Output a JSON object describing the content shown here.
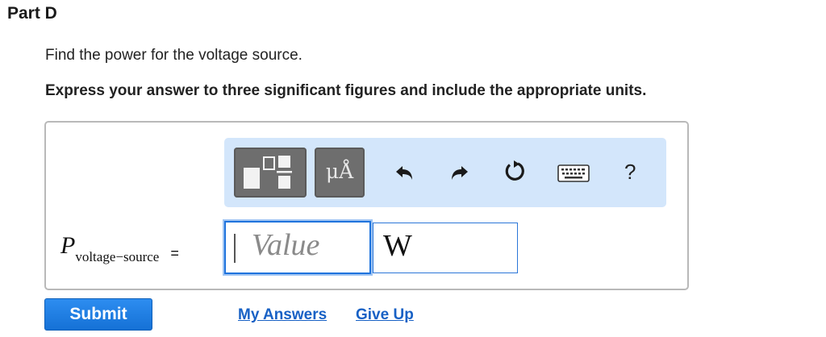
{
  "part": {
    "title": "Part D"
  },
  "question": {
    "text": "Find the power for the voltage source.",
    "instruction": "Express your answer to three significant figures and include the appropriate units."
  },
  "toolbar": {
    "template_icon": "fraction-template-icon",
    "units_label": "μÅ",
    "undo_icon": "undo-icon",
    "redo_icon": "redo-icon",
    "reset_icon": "reset-icon",
    "keyboard_icon": "keyboard-icon",
    "help_label": "?"
  },
  "equation": {
    "symbol": "P",
    "subscript": "voltage−source",
    "equals": "="
  },
  "inputs": {
    "value_placeholder": "Value",
    "unit_value": "W"
  },
  "actions": {
    "submit_label": "Submit",
    "my_answers_label": "My Answers",
    "give_up_label": "Give Up"
  },
  "colors": {
    "toolbar_bg": "#d3e6fb",
    "accent_blue": "#1e73dd",
    "submit_bg": "#1f80e3",
    "link": "#1861c5"
  }
}
